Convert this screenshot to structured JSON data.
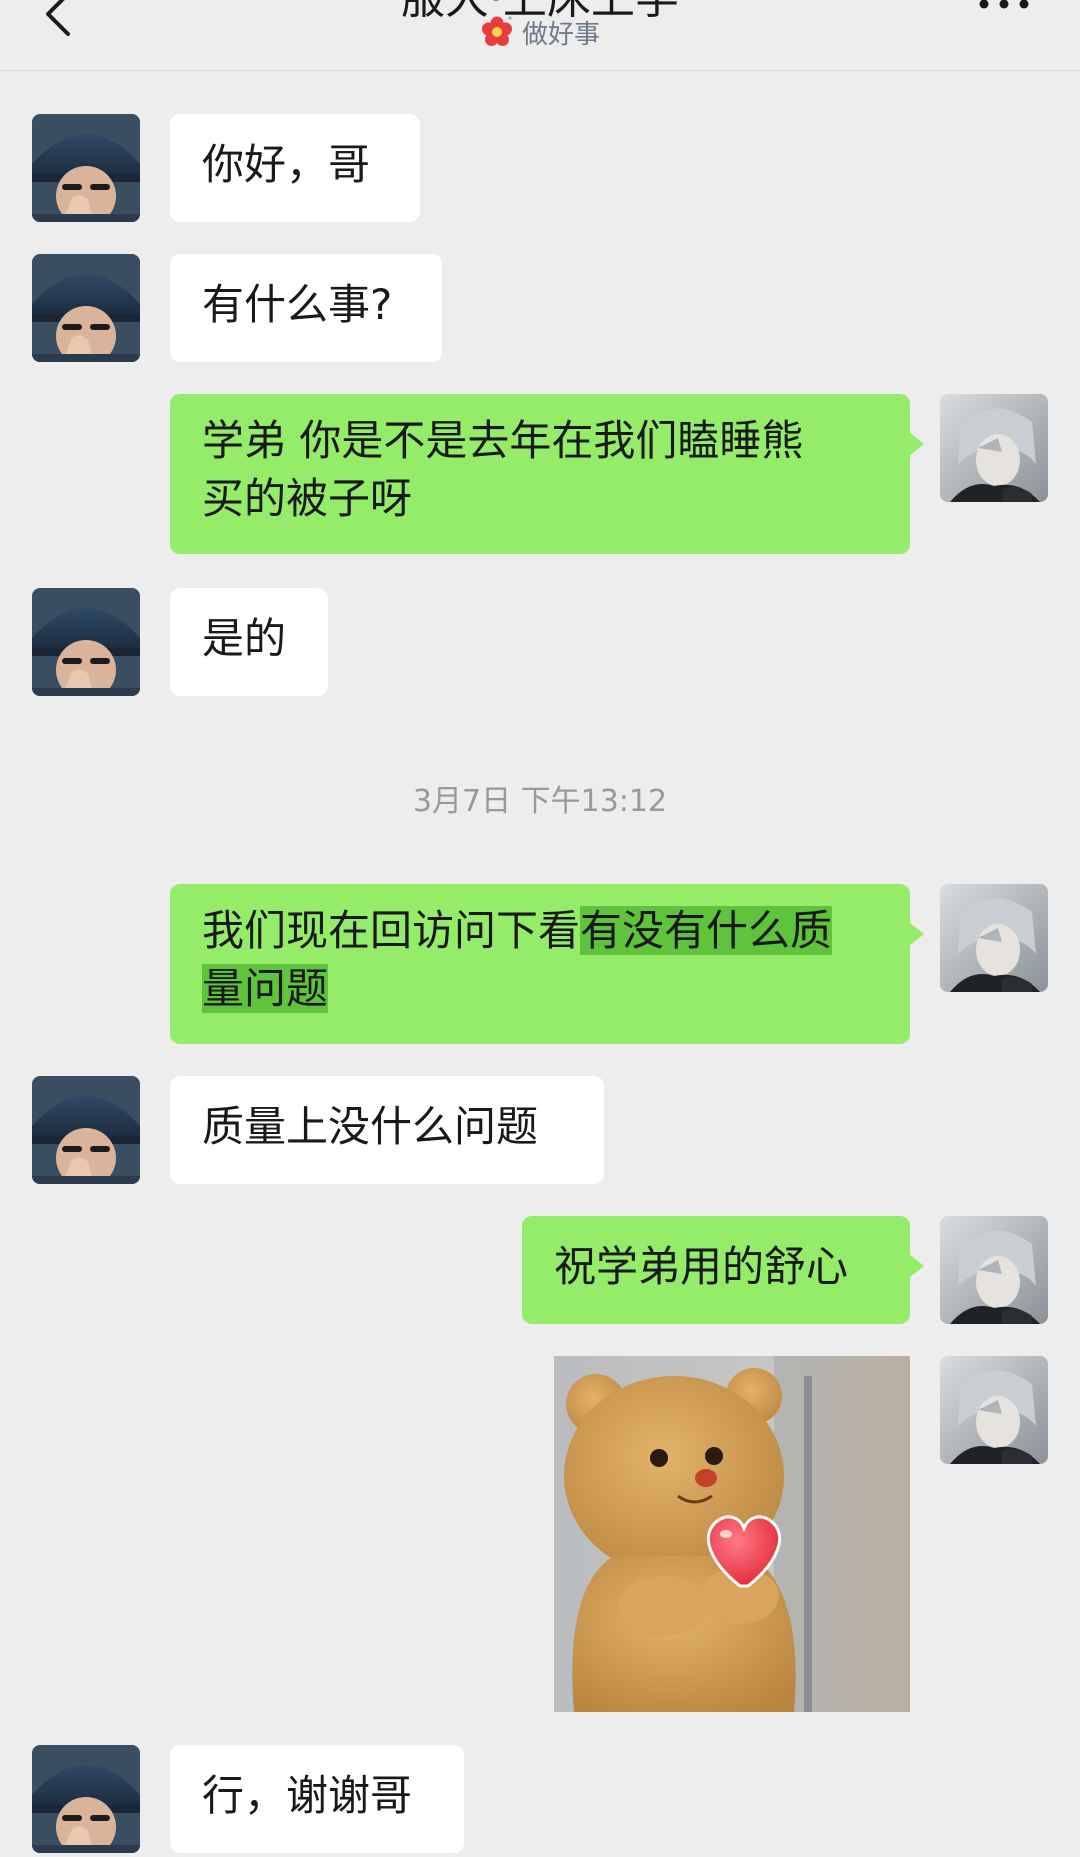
{
  "header": {
    "title": "服大·上床上学",
    "status_text": "做好事",
    "status_icon": "red-flower-icon",
    "back_icon": "chevron-left-icon",
    "more_icon": "more-dots-icon"
  },
  "timestamp": "3月7日 下午13:12",
  "messages": [
    {
      "side": "in",
      "text": "你好，哥"
    },
    {
      "side": "in",
      "text": "有什么事?"
    },
    {
      "side": "out",
      "line1": "学弟 你是不是去年在我们瞌睡熊",
      "line2": "买的被子呀"
    },
    {
      "side": "in",
      "text": "是的"
    },
    {
      "side": "out",
      "line1_plain": "我们现在回访问下看",
      "line1_highlight": "有没有什么质",
      "line2_highlight": "量问题"
    },
    {
      "side": "in",
      "text": "质量上没什么问题"
    },
    {
      "side": "out",
      "text": "祝学弟用的舒心"
    },
    {
      "side": "out",
      "type": "sticker",
      "description": "bear-mascot-holding-heart"
    },
    {
      "side": "in",
      "text": "行，谢谢哥"
    }
  ],
  "colors": {
    "background": "#ededed",
    "incoming_bubble": "#ffffff",
    "outgoing_bubble": "#95ec69",
    "highlight": "#60c33c",
    "timestamp": "#999999"
  }
}
